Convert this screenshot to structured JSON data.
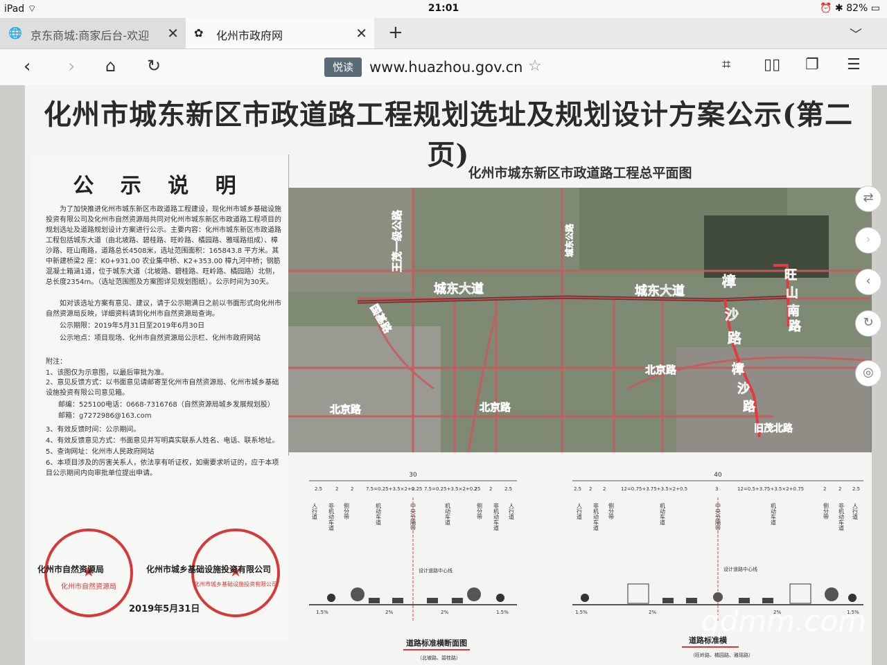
{
  "status": {
    "device": "iPad",
    "time": "21:01",
    "battery": "82%"
  },
  "tabs": [
    {
      "title": "京东商城:商家后台-欢迎"
    },
    {
      "title": "化州市政府网"
    }
  ],
  "nav": {
    "read_label": "悦读",
    "url": "www.huazhou.gov.cn"
  },
  "poster": {
    "title": "化州市城东新区市政道路工程规划选址及规划设计方案公示(第二页)",
    "notice": {
      "heading": "公 示 说 明",
      "p1": "为了加快推进化州市城东新区市政道路工程建设，现化州市城乡基础设施投资有限公司及化州市自然资源局共同对化州市城东新区市政道路工程项目的规划选址及道路规划设计方案进行公示。主要内容：化州市城东新区市政道路工程包括城东大道（由北坡路、碧桂路、旺岭路、橘园路、雅瑶路组成）、樟沙路、旺山南路，道路总长4508米，选址范围面积：165843.8 平方米。其中新建桥梁2 座：K0+931.00 农业集中桥、K2+353.00 樟九河中桥；钢筋混凝土箱涵1道，位于城东大道（北坡路、碧桂路、旺岭路、橘园路）北侧，总长度2354m。（选址范围图及方案图详见规划图纸）。公示时间为30天。",
      "p2": "如对该选址方案有意见、建议，请于公示期满日之前以书面形式向化州市自然资源局反映，详细资料请到化州市自然资源局查询。",
      "period": "公示期限：2019年5月31日至2019年6月30日",
      "place": "公示地点：项目现场、化州市自然资源局公示栏、化州市政府网站",
      "notes_title": "附注：",
      "notes": [
        "1、该图仅为示意图，以最后审批为准。",
        "2、意见反馈方式：以书面意见请邮寄至化州市自然资源局、化州市城乡基础设施投资有限公司意见箱。",
        "邮编：525100电话：0668-7316768（自然资源局城乡发展规划股）",
        "邮箱：g7272986@163.com",
        "3、有效反馈时间：公示期间。",
        "4、有效反馈意见方式：书面意见并写明真实联系人姓名、电话、联系地址。",
        "5、查询网址：化州市人民政府网站",
        "6、本项目涉及的厉害关系人，依法享有听证权，如需要求听证的，应于本项目公示期间内向审批单位提出申请。"
      ],
      "sign1": "化州市自然资源局",
      "sign2": "化州市城乡基础设施投资有限公司",
      "date": "2019年5月31日",
      "seal1": "化州市自然资源局",
      "seal2": "化州市城乡基础设施投资有限公司"
    },
    "map_title": "化州市城东新区市政道路工程总平面图",
    "map_labels": [
      "王茂一级公路",
      "城东大道",
      "城东大道",
      "樟",
      "沙",
      "路",
      "旺",
      "山",
      "南",
      "路",
      "国基路",
      "北京路",
      "北京路",
      "北京路",
      "樟",
      "沙",
      "路",
      "旧茂北路",
      "城东公路"
    ],
    "xsec": {
      "left_total": "30",
      "left_dims": [
        "2.5",
        "2",
        "2",
        "7.5=0.25+3.5×2+0.25",
        "2",
        "7.5=0.25+3.5×2+0.25",
        "2",
        "2",
        "2.5"
      ],
      "right_total": "40",
      "right_dims": [
        "2.5",
        "2",
        "2",
        "12=0.75+3.75+3.5×2+0.5",
        "3",
        "12=0.5+3.75+3.5×2+0.75",
        "2",
        "2",
        "2.5"
      ],
      "lane_labels": [
        "人行道",
        "非机动车道",
        "侧分带",
        "机动车道",
        "中央分隔带",
        "机动车道",
        "侧分带",
        "非机动车道",
        "人行道"
      ],
      "centerline": "设计道路中心线",
      "grade_side": "1.5%",
      "grade_mid": "2%",
      "caption_left": "道路标准横断面图",
      "sub_left": "（北坡路、碧桂路）",
      "caption_right": "道路标准横",
      "sub_right": "（旺岭路、橘园路、雅瑶路）"
    }
  },
  "watermark": "gdmm.com"
}
